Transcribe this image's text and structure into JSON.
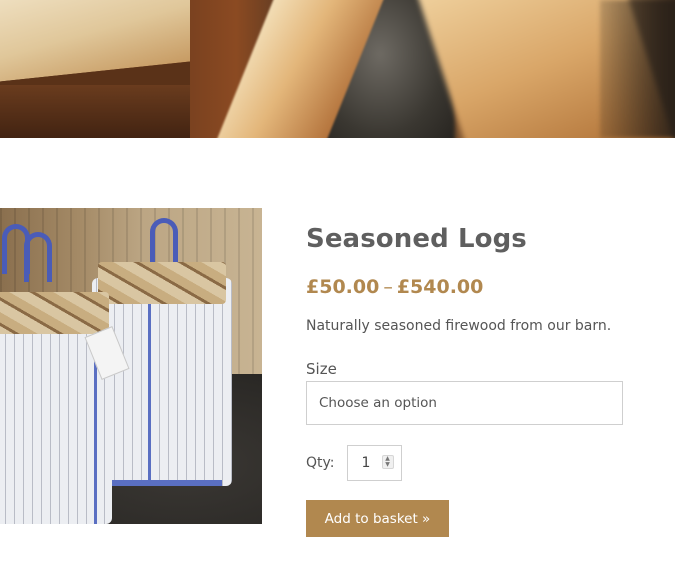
{
  "product": {
    "title": "Seasoned Logs",
    "price_min": "£50.00",
    "price_separator": "–",
    "price_max": "£540.00",
    "description": "Naturally seasoned firewood from our barn.",
    "size": {
      "label": "Size",
      "selected": "Choose an option"
    },
    "quantity": {
      "label": "Qty:",
      "value": "1"
    },
    "add_to_basket_label": "Add to basket »"
  },
  "colors": {
    "accent": "#b1884f",
    "title": "#5f5f5f",
    "text": "#555555",
    "border": "#cfcfcf"
  },
  "icons": {
    "qty_spinner": "spinner-arrows-icon"
  }
}
